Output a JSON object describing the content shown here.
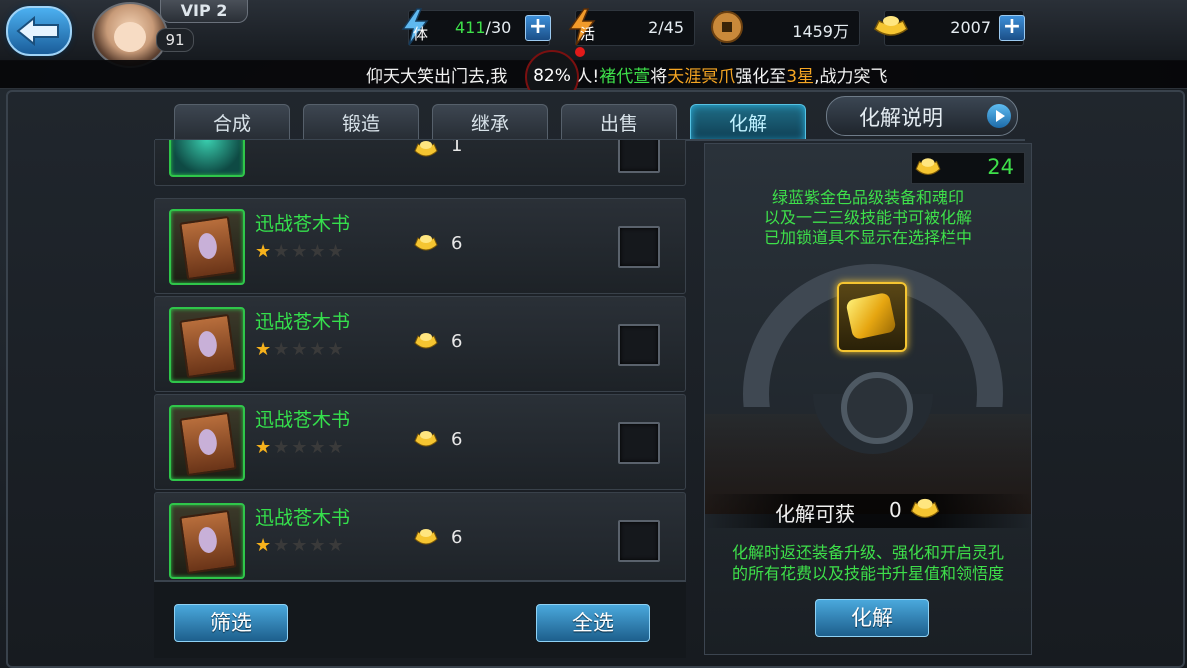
{
  "header": {
    "vip": "VIP 2",
    "level": "91",
    "stamina": {
      "current": "411",
      "max": "/30",
      "icon_text": "体"
    },
    "activity": {
      "value": "2/45",
      "icon_text": "活"
    },
    "copper": "1459万",
    "gold": "2007"
  },
  "ticker": {
    "part1": "仰天大笑出门去,我",
    "part2": "蓬蒿人!",
    "name": "褚代萱",
    "mid": "将",
    "item": "天涯冥爪",
    "mid2": "强化至",
    "stars": "3星",
    "tail": ",战力突飞"
  },
  "fps": "82%",
  "tabs": [
    {
      "label": "合成"
    },
    {
      "label": "锻造"
    },
    {
      "label": "继承"
    },
    {
      "label": "出售"
    },
    {
      "label": "化解",
      "active": true
    }
  ],
  "explain_label": "化解说明",
  "items": [
    {
      "name": "",
      "stars": 0,
      "qty": "1"
    },
    {
      "name": "迅战苍木书",
      "stars": 1,
      "qty": "6"
    },
    {
      "name": "迅战苍木书",
      "stars": 1,
      "qty": "6"
    },
    {
      "name": "迅战苍木书",
      "stars": 1,
      "qty": "6"
    },
    {
      "name": "迅战苍木书",
      "stars": 1,
      "qty": "6"
    }
  ],
  "filter_label": "筛选",
  "select_all_label": "全选",
  "panel": {
    "total": "24",
    "info_line1": "绿蓝紫金色品级装备和魂印",
    "info_line2": "以及一二三级技能书可被化解",
    "info_line3": "已加锁道具不显示在选择栏中",
    "gain_label": "化解可获",
    "gain_value": "0",
    "note_line1": "化解时返还装备升级、强化和开启灵孔",
    "note_line2": "的所有花费以及技能书升星值和领悟度",
    "dissolve_label": "化解"
  },
  "colors": {
    "green_text": "#3ee04a",
    "active_tab": "#1f6d86",
    "gold": "#f5c531"
  }
}
